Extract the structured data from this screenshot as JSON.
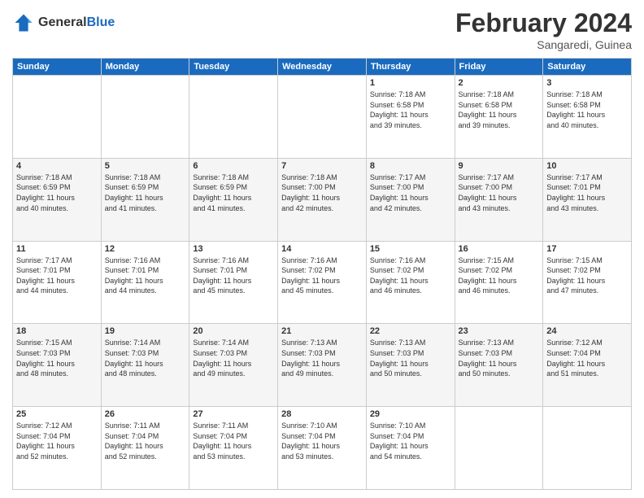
{
  "header": {
    "logo_line1": "General",
    "logo_line2": "Blue",
    "month_title": "February 2024",
    "subtitle": "Sangaredi, Guinea"
  },
  "days_of_week": [
    "Sunday",
    "Monday",
    "Tuesday",
    "Wednesday",
    "Thursday",
    "Friday",
    "Saturday"
  ],
  "weeks": [
    [
      {
        "day": "",
        "info": ""
      },
      {
        "day": "",
        "info": ""
      },
      {
        "day": "",
        "info": ""
      },
      {
        "day": "",
        "info": ""
      },
      {
        "day": "1",
        "info": "Sunrise: 7:18 AM\nSunset: 6:58 PM\nDaylight: 11 hours\nand 39 minutes."
      },
      {
        "day": "2",
        "info": "Sunrise: 7:18 AM\nSunset: 6:58 PM\nDaylight: 11 hours\nand 39 minutes."
      },
      {
        "day": "3",
        "info": "Sunrise: 7:18 AM\nSunset: 6:58 PM\nDaylight: 11 hours\nand 40 minutes."
      }
    ],
    [
      {
        "day": "4",
        "info": "Sunrise: 7:18 AM\nSunset: 6:59 PM\nDaylight: 11 hours\nand 40 minutes."
      },
      {
        "day": "5",
        "info": "Sunrise: 7:18 AM\nSunset: 6:59 PM\nDaylight: 11 hours\nand 41 minutes."
      },
      {
        "day": "6",
        "info": "Sunrise: 7:18 AM\nSunset: 6:59 PM\nDaylight: 11 hours\nand 41 minutes."
      },
      {
        "day": "7",
        "info": "Sunrise: 7:18 AM\nSunset: 7:00 PM\nDaylight: 11 hours\nand 42 minutes."
      },
      {
        "day": "8",
        "info": "Sunrise: 7:17 AM\nSunset: 7:00 PM\nDaylight: 11 hours\nand 42 minutes."
      },
      {
        "day": "9",
        "info": "Sunrise: 7:17 AM\nSunset: 7:00 PM\nDaylight: 11 hours\nand 43 minutes."
      },
      {
        "day": "10",
        "info": "Sunrise: 7:17 AM\nSunset: 7:01 PM\nDaylight: 11 hours\nand 43 minutes."
      }
    ],
    [
      {
        "day": "11",
        "info": "Sunrise: 7:17 AM\nSunset: 7:01 PM\nDaylight: 11 hours\nand 44 minutes."
      },
      {
        "day": "12",
        "info": "Sunrise: 7:16 AM\nSunset: 7:01 PM\nDaylight: 11 hours\nand 44 minutes."
      },
      {
        "day": "13",
        "info": "Sunrise: 7:16 AM\nSunset: 7:01 PM\nDaylight: 11 hours\nand 45 minutes."
      },
      {
        "day": "14",
        "info": "Sunrise: 7:16 AM\nSunset: 7:02 PM\nDaylight: 11 hours\nand 45 minutes."
      },
      {
        "day": "15",
        "info": "Sunrise: 7:16 AM\nSunset: 7:02 PM\nDaylight: 11 hours\nand 46 minutes."
      },
      {
        "day": "16",
        "info": "Sunrise: 7:15 AM\nSunset: 7:02 PM\nDaylight: 11 hours\nand 46 minutes."
      },
      {
        "day": "17",
        "info": "Sunrise: 7:15 AM\nSunset: 7:02 PM\nDaylight: 11 hours\nand 47 minutes."
      }
    ],
    [
      {
        "day": "18",
        "info": "Sunrise: 7:15 AM\nSunset: 7:03 PM\nDaylight: 11 hours\nand 48 minutes."
      },
      {
        "day": "19",
        "info": "Sunrise: 7:14 AM\nSunset: 7:03 PM\nDaylight: 11 hours\nand 48 minutes."
      },
      {
        "day": "20",
        "info": "Sunrise: 7:14 AM\nSunset: 7:03 PM\nDaylight: 11 hours\nand 49 minutes."
      },
      {
        "day": "21",
        "info": "Sunrise: 7:13 AM\nSunset: 7:03 PM\nDaylight: 11 hours\nand 49 minutes."
      },
      {
        "day": "22",
        "info": "Sunrise: 7:13 AM\nSunset: 7:03 PM\nDaylight: 11 hours\nand 50 minutes."
      },
      {
        "day": "23",
        "info": "Sunrise: 7:13 AM\nSunset: 7:03 PM\nDaylight: 11 hours\nand 50 minutes."
      },
      {
        "day": "24",
        "info": "Sunrise: 7:12 AM\nSunset: 7:04 PM\nDaylight: 11 hours\nand 51 minutes."
      }
    ],
    [
      {
        "day": "25",
        "info": "Sunrise: 7:12 AM\nSunset: 7:04 PM\nDaylight: 11 hours\nand 52 minutes."
      },
      {
        "day": "26",
        "info": "Sunrise: 7:11 AM\nSunset: 7:04 PM\nDaylight: 11 hours\nand 52 minutes."
      },
      {
        "day": "27",
        "info": "Sunrise: 7:11 AM\nSunset: 7:04 PM\nDaylight: 11 hours\nand 53 minutes."
      },
      {
        "day": "28",
        "info": "Sunrise: 7:10 AM\nSunset: 7:04 PM\nDaylight: 11 hours\nand 53 minutes."
      },
      {
        "day": "29",
        "info": "Sunrise: 7:10 AM\nSunset: 7:04 PM\nDaylight: 11 hours\nand 54 minutes."
      },
      {
        "day": "",
        "info": ""
      },
      {
        "day": "",
        "info": ""
      }
    ]
  ]
}
